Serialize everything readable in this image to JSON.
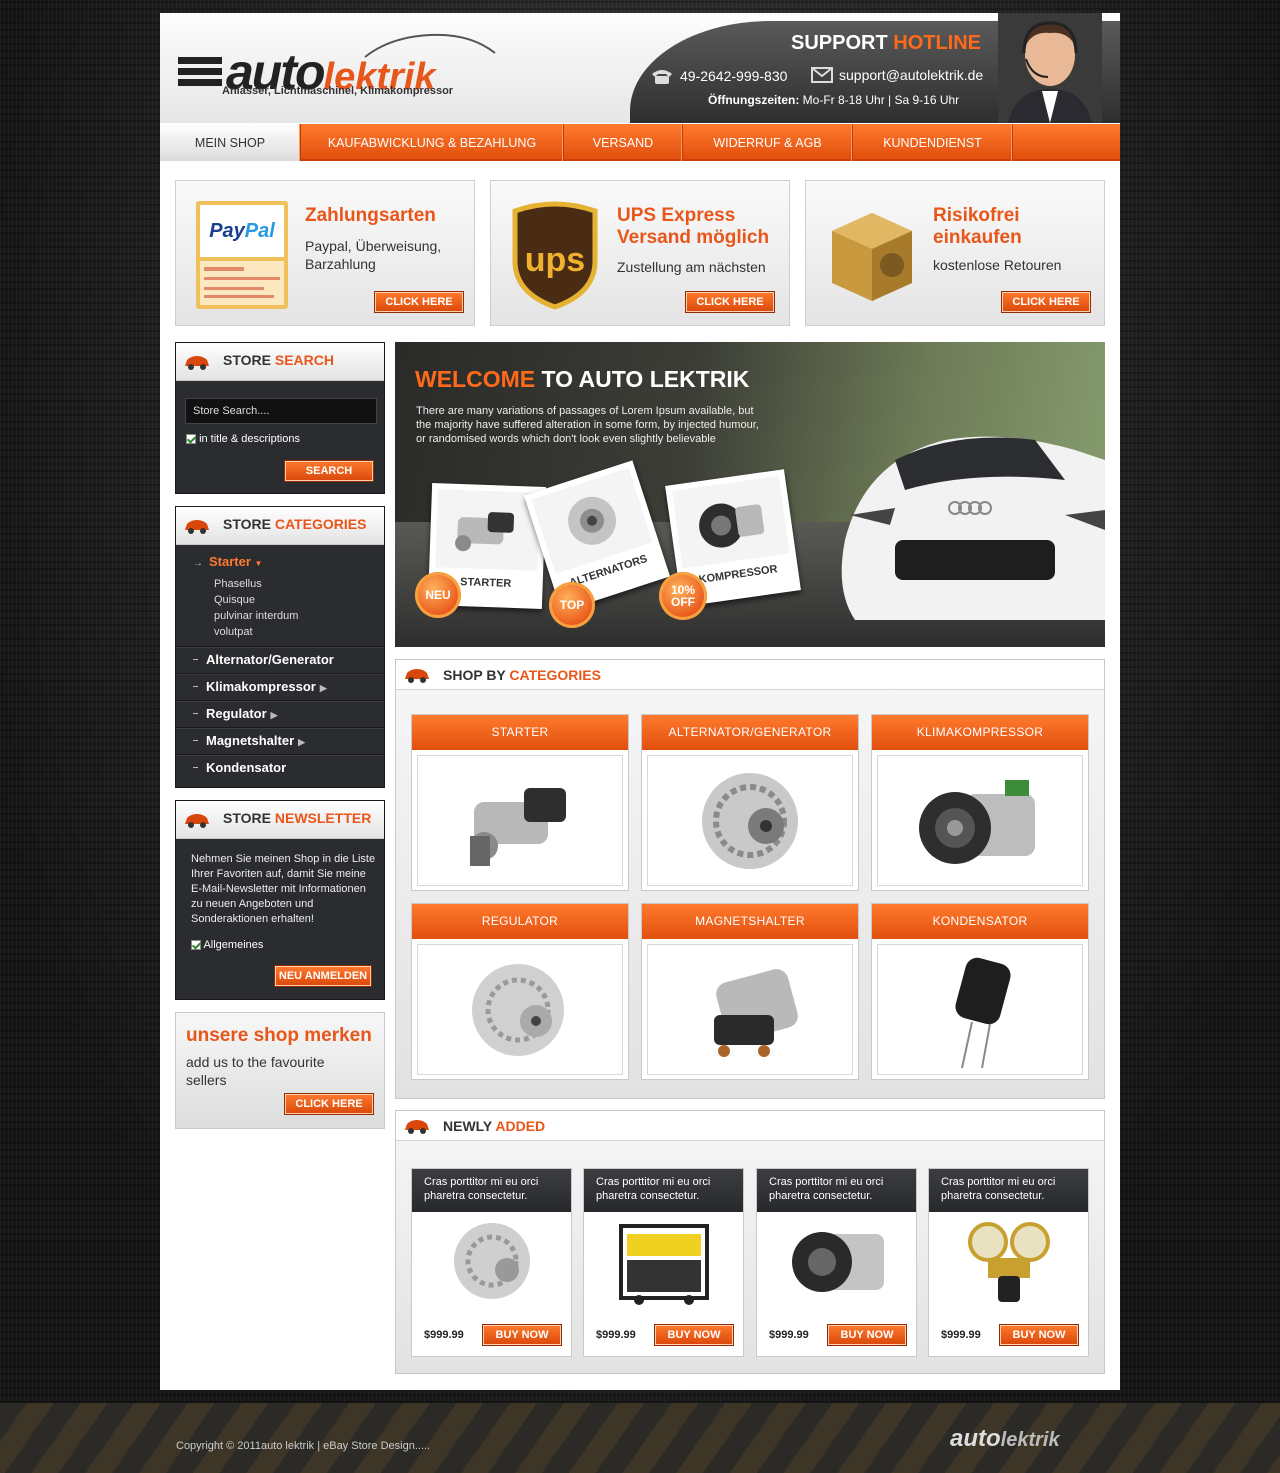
{
  "header": {
    "logo_auto": "auto",
    "logo_lektrik": "lektrik",
    "tagline": "Anlasser, Lichtmaschinel, Klimakompressor",
    "support_a": "SUPPORT",
    "support_b": "HOTLINE",
    "phone": "49-2642-999-830",
    "email": "support@autolektrik.de",
    "hours_label": "Öffnungszeiten:",
    "hours_value": "Mo-Fr 8-18 Uhr  |  Sa 9-16 Uhr"
  },
  "nav": [
    "MEIN SHOP",
    "KAUFABWICKLUNG & BEZAHLUNG",
    "VERSAND",
    "WIDERRUF & AGB",
    "KUNDENDIENST"
  ],
  "promos": [
    {
      "title": "Zahlungsarten",
      "text": "Paypal, Überweisung, Barzahlung",
      "button": "CLICK HERE",
      "icon": "paypal-icon"
    },
    {
      "title": "UPS Express Versand möglich",
      "text": "Zustellung am nächsten",
      "button": "CLICK HERE",
      "icon": "ups-icon"
    },
    {
      "title": "Risikofrei einkaufen",
      "text": "kostenlose Retouren",
      "button": "CLICK HERE",
      "icon": "package-icon"
    }
  ],
  "search": {
    "head_a": "STORE",
    "head_b": "SEARCH",
    "placeholder": "Store Search....",
    "checkbox": "in title & descriptions",
    "button": "SEARCH"
  },
  "categories": {
    "head_a": "STORE",
    "head_b": "CATEGORIES",
    "active": "Starter",
    "sub": [
      "Phasellus",
      "Quisque",
      "pulvinar interdum",
      "volutpat"
    ],
    "items": [
      "Alternator/Generator",
      "Klimakompressor",
      "Regulator",
      "Magnetshalter",
      "Kondensator"
    ]
  },
  "newsletter": {
    "head_a": "STORE",
    "head_b": "NEWSLETTER",
    "text": "Nehmen Sie meinen Shop in die Liste Ihrer Favoriten auf, damit Sie meine E-Mail-Newsletter mit Informationen zu neuen Angeboten und Sonderaktionen erhalten!",
    "checkbox": "Allgemeines",
    "button": "NEU ANMELDEN"
  },
  "favourite": {
    "title": "unsere shop merken",
    "text": "add us to the favourite sellers",
    "button": "CLICK HERE"
  },
  "banner": {
    "title_a": "WELCOME",
    "title_b": "TO AUTO LEKTRIK",
    "text": "There are many variations of passages of Lorem Ipsum available, but the majority have suffered alteration in some form, by injected humour, or randomised words which don't look even slightly believable",
    "cards": [
      "STARTER",
      "ALTERNATORS",
      "KOMPRESSOR"
    ],
    "badges": [
      "NEU",
      "TOP",
      "10% OFF"
    ]
  },
  "shop_by": {
    "head_a": "SHOP BY",
    "head_b": "CATEGORIES",
    "cards": [
      "STARTER",
      "ALTERNATOR/GENERATOR",
      "KLIMAKOMPRESSOR",
      "REGULATOR",
      "MAGNETSHALTER",
      "KONDENSATOR"
    ]
  },
  "newly": {
    "head_a": "NEWLY",
    "head_b": "ADDED",
    "products": [
      {
        "desc": "Cras porttitor mi eu orci pharetra consectetur.",
        "price": "$999.99",
        "button": "BUY NOW"
      },
      {
        "desc": "Cras porttitor mi eu orci pharetra consectetur.",
        "price": "$999.99",
        "button": "BUY NOW"
      },
      {
        "desc": "Cras porttitor mi eu orci pharetra consectetur.",
        "price": "$999.99",
        "button": "BUY NOW"
      },
      {
        "desc": "Cras porttitor mi eu orci pharetra consectetur.",
        "price": "$999.99",
        "button": "BUY NOW"
      }
    ]
  },
  "footer": {
    "copyright": "Copyright © 2011auto lektrik | eBay Store Design.....",
    "logo_auto": "auto",
    "logo_lektrik": "lektrik"
  },
  "colors": {
    "accent": "#e8561a",
    "dark": "#2a2c30"
  }
}
